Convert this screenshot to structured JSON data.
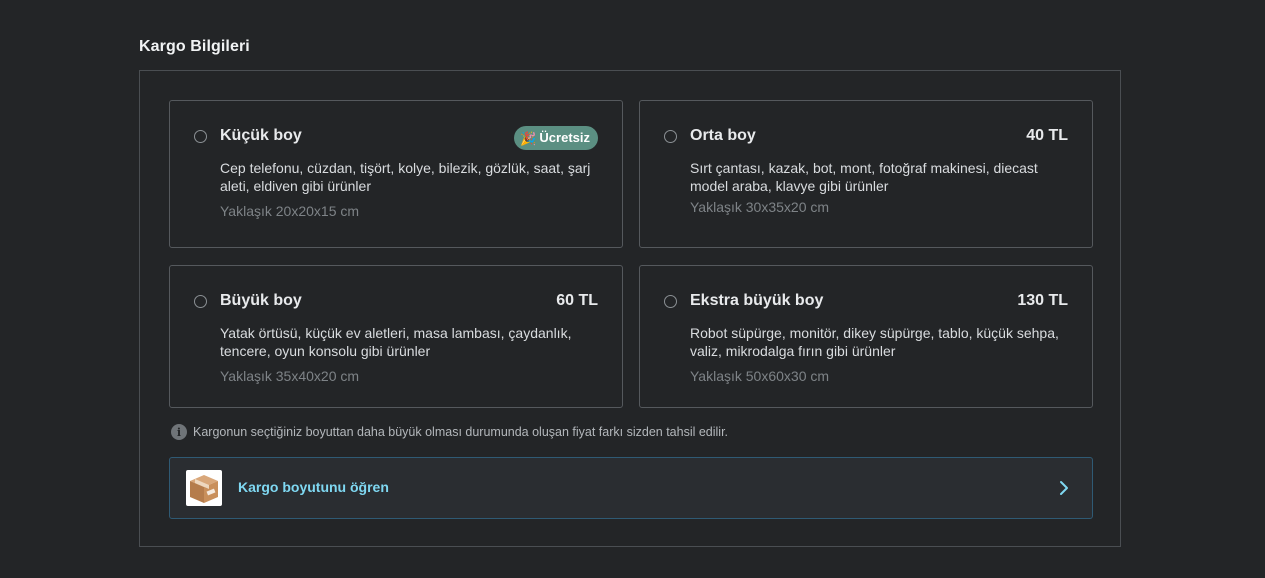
{
  "section": {
    "title": "Kargo Bilgileri"
  },
  "options": [
    {
      "title": "Küçük boy",
      "badge": "Ücretsiz",
      "badge_icon": "party-popper-icon",
      "price": "",
      "description": "Cep telefonu, cüzdan, tişört, kolye, bilezik, gözlük, saat, şarj aleti, eldiven gibi ürünler",
      "dimensions": "Yaklaşık 20x20x15 cm",
      "selected": false
    },
    {
      "title": "Orta boy",
      "price": "40 TL",
      "description": "Sırt çantası, kazak, bot, mont, fotoğraf makinesi, diecast model araba, klavye gibi ürünler",
      "dimensions": "Yaklaşık 30x35x20 cm",
      "selected": false
    },
    {
      "title": "Büyük boy",
      "price": "60 TL",
      "description": "Yatak örtüsü, küçük ev aletleri, masa lambası, çaydanlık, tencere, oyun konsolu gibi ürünler",
      "dimensions": "Yaklaşık 35x40x20 cm",
      "selected": false
    },
    {
      "title": "Ekstra büyük boy",
      "price": "130 TL",
      "description": "Robot süpürge, monitör, dikey süpürge, tablo, küçük sehpa, valiz, mikrodalga fırın gibi ürünler",
      "dimensions": "Yaklaşık 50x60x30 cm",
      "selected": false
    }
  ],
  "info": {
    "icon": "info-icon",
    "text": "Kargonun seçtiğiniz boyuttan daha büyük olması durumunda oluşan fiyat farkı sizden tahsil edilir."
  },
  "learn_size": {
    "label": "Kargo boyutunu öğren",
    "image": "cardboard-box-image",
    "icon": "chevron-right-icon"
  },
  "colors": {
    "background": "#232527",
    "badge": "#5b8f82",
    "link_accent": "#7fd8f2",
    "link_border": "#2f5a74"
  }
}
